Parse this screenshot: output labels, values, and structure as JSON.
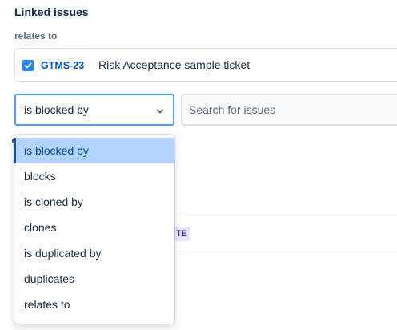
{
  "section": {
    "title": "Linked issues",
    "group_label": "relates to"
  },
  "linked_issue": {
    "key": "GTMS-23",
    "summary": "Risk Acceptance sample ticket",
    "checked": true
  },
  "link_type_select": {
    "value": "is blocked by",
    "options": [
      "is blocked by",
      "blocks",
      "is cloned by",
      "clones",
      "is duplicated by",
      "duplicates",
      "relates to"
    ],
    "selected_index": 0
  },
  "search": {
    "placeholder": "Search for issues"
  },
  "colors": {
    "accent": "#0052cc",
    "focus_border": "#4c9aff",
    "selected_bg": "#b3d4ff",
    "checkbox": "#2684ff"
  }
}
